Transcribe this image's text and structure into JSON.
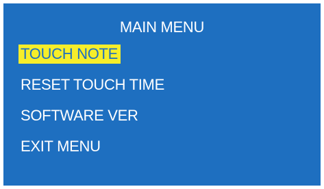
{
  "menu": {
    "title": "MAIN MENU",
    "selected_index": 0,
    "items": [
      {
        "label": "TOUCH NOTE",
        "selected": true
      },
      {
        "label": "RESET TOUCH TIME",
        "selected": false
      },
      {
        "label": "SOFTWARE VER",
        "selected": false
      },
      {
        "label": "EXIT MENU",
        "selected": false
      }
    ]
  },
  "colors": {
    "background": "#1e6fc0",
    "text": "#ffffff",
    "highlight_background": "#f6ee2a",
    "highlight_text": "#1e6fc0"
  }
}
